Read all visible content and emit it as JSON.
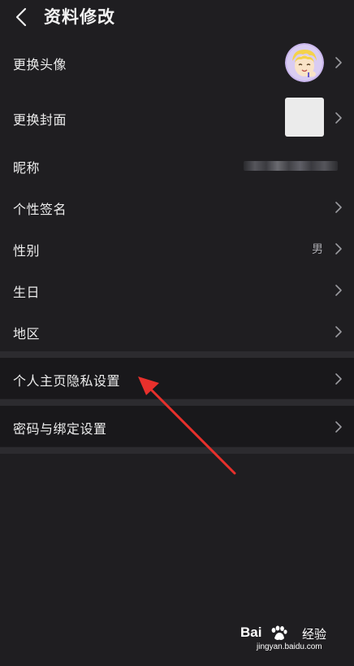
{
  "header": {
    "title": "资料修改"
  },
  "profile": {
    "avatar_label": "更换头像",
    "cover_label": "更换封面",
    "nickname_label": "昵称",
    "signature_label": "个性签名",
    "gender_label": "性别",
    "gender_value": "男",
    "birthday_label": "生日",
    "region_label": "地区"
  },
  "privacy": {
    "label": "个人主页隐私设置"
  },
  "security": {
    "label": "密码与绑定设置"
  },
  "watermark": {
    "brand_left": "Bai",
    "brand_right": "经验",
    "url": "jingyan.baidu.com"
  },
  "colors": {
    "background": "#1f1e21",
    "separator": "#2c2b2f",
    "annotation_arrow": "#e8302c"
  }
}
